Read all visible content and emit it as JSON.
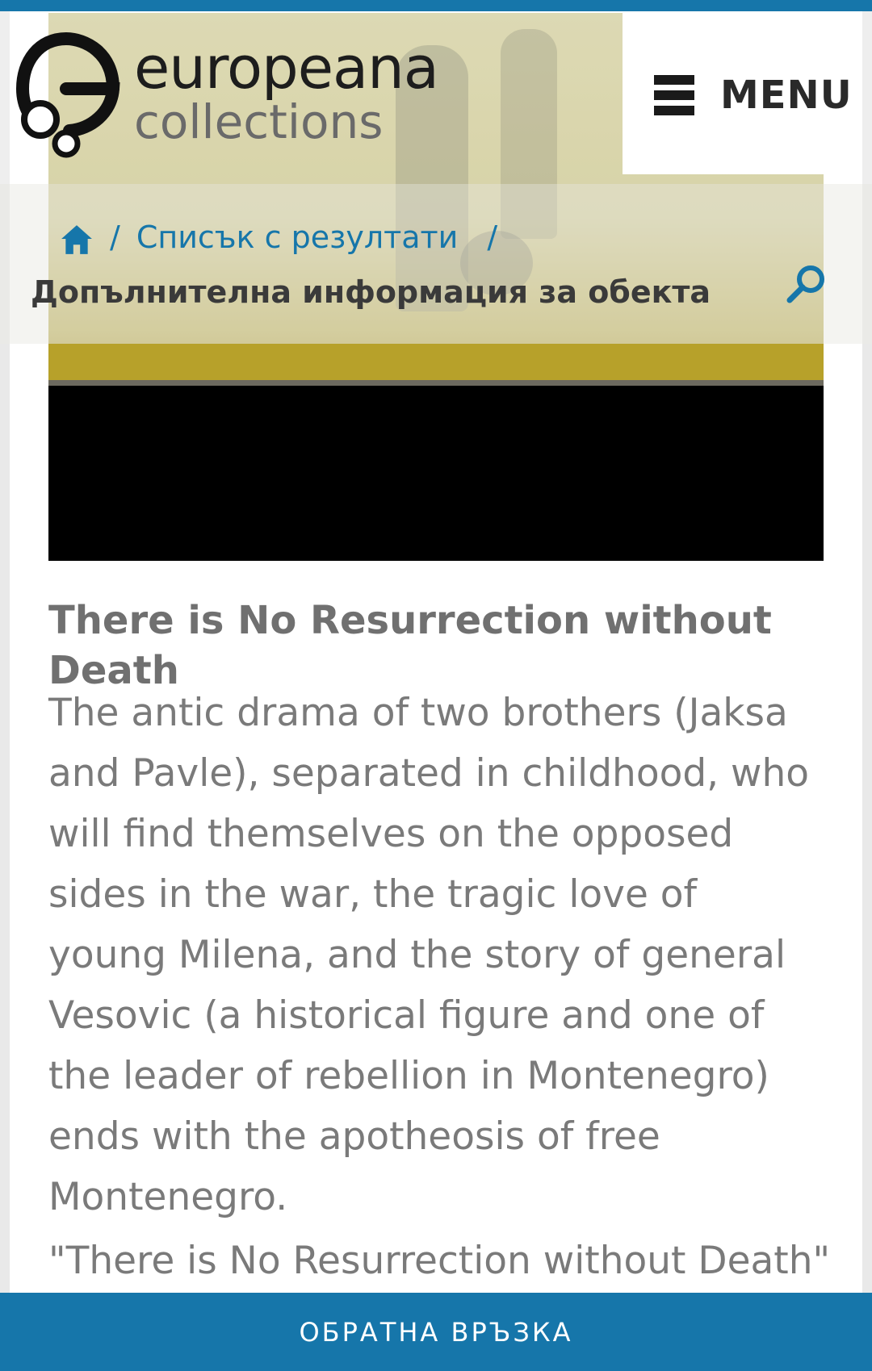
{
  "header": {
    "logo_line1": "europeana",
    "logo_line2": "collections",
    "menu_label": "MENU"
  },
  "breadcrumb": {
    "home_icon": "home-icon",
    "separator": "/",
    "results_label": "Списък с резултати",
    "current_label": "Допълнителна информация за обекта"
  },
  "search": {
    "icon": "search-icon"
  },
  "item": {
    "title": "There is No Resurrection without Death",
    "description": "The antic drama of two brothers (Jaksa and Pavle), separated in childhood, who will find themselves on the opposed sides in the war, the tragic love of young Milena, and the story of general Vesovic (a historical figure and one of the leader of rebellion in Montenegro) ends with the apotheosis of free Montenegro.",
    "quote": "\"There is No Resurrection without Death\""
  },
  "footer": {
    "feedback_label": "ОБРАТНА ВРЪЗКА"
  },
  "colors": {
    "accent": "#1676aa",
    "text": "#7a7a7a",
    "dark": "#2a2a2a"
  }
}
